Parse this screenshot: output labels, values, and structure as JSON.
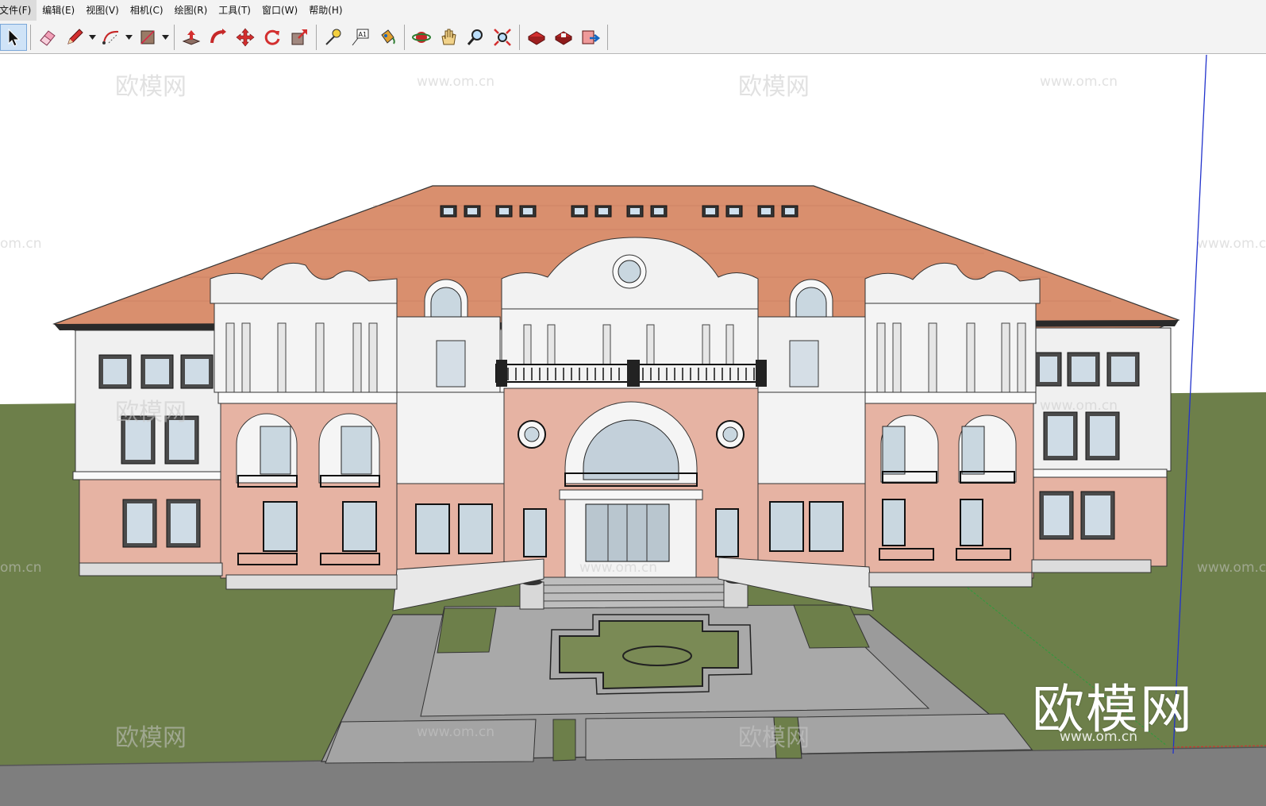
{
  "menu": {
    "items": [
      "文件(F)",
      "编辑(E)",
      "视图(V)",
      "相机(C)",
      "绘图(R)",
      "工具(T)",
      "窗口(W)",
      "帮助(H)"
    ]
  },
  "toolbar": {
    "tools": [
      {
        "name": "select-icon",
        "active": true
      },
      {
        "name": "eraser-icon"
      },
      {
        "name": "pencil-icon",
        "dropdown": true
      },
      {
        "name": "arc-icon",
        "dropdown": true
      },
      {
        "name": "rectangle-icon",
        "dropdown": true
      },
      {
        "name": "push-pull-icon"
      },
      {
        "name": "follow-me-icon"
      },
      {
        "name": "move-icon"
      },
      {
        "name": "rotate-icon"
      },
      {
        "name": "scale-icon"
      },
      {
        "name": "tape-measure-icon"
      },
      {
        "name": "text-icon"
      },
      {
        "name": "paint-bucket-icon"
      },
      {
        "name": "orbit-icon"
      },
      {
        "name": "pan-icon"
      },
      {
        "name": "zoom-icon"
      },
      {
        "name": "zoom-extents-icon"
      },
      {
        "name": "warehouse-icon"
      },
      {
        "name": "extension-warehouse-icon"
      },
      {
        "name": "share-model-icon"
      }
    ],
    "text_tool_glyph": "A1"
  },
  "watermarks": {
    "logo_cn": "欧模网",
    "url": "www.om.cn",
    "url_short": "om.cn"
  },
  "colors": {
    "sky": "#ffffff",
    "grass": "#6d7f4a",
    "roof": "#d98f6e",
    "brick": "#e5b4a5",
    "wall": "#f2f2f2",
    "paving": "#9a9a9a"
  }
}
